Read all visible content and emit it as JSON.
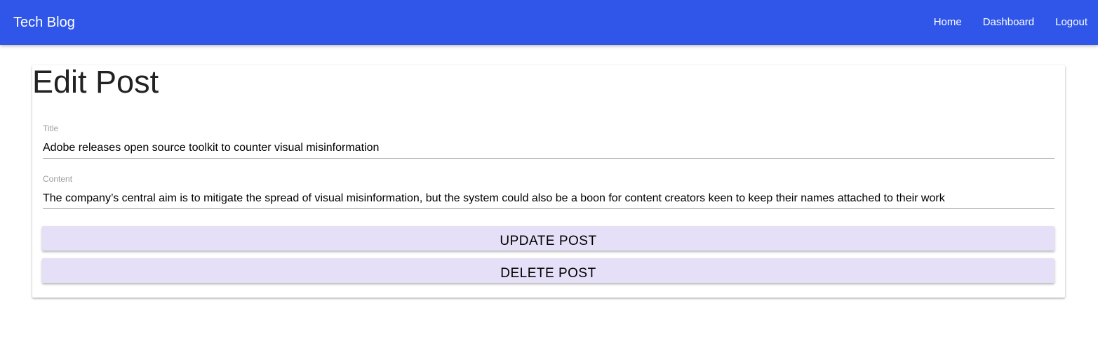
{
  "navbar": {
    "brand": "Tech Blog",
    "links": [
      {
        "label": "Home"
      },
      {
        "label": "Dashboard"
      },
      {
        "label": "Logout"
      }
    ],
    "background_color": "#2f56e8"
  },
  "edit_post": {
    "heading": "Edit Post",
    "title_field": {
      "label": "Title",
      "value": "Adobe releases open source toolkit to counter visual misinformation"
    },
    "content_field": {
      "label": "Content",
      "value": "The company’s central aim is to mitigate the spread of visual misinformation, but the system could also be a boon for content creators keen to keep their names attached to their work"
    },
    "update_button": "UPDATE POST",
    "delete_button": "DELETE POST",
    "button_color": "#e5e0f7"
  }
}
